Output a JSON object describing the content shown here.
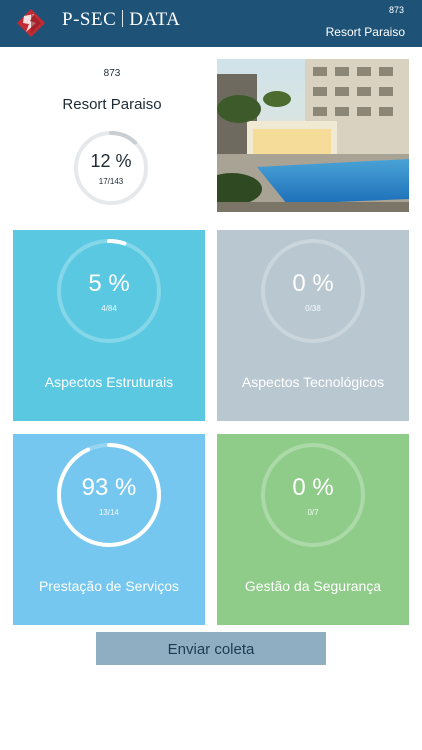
{
  "header": {
    "brand_left": "P-SEC",
    "brand_right": "DATA",
    "code": "873",
    "name": "Resort Paraiso",
    "logo_icon": "psec-logo-icon"
  },
  "summary": {
    "code": "873",
    "name": "Resort Paraiso",
    "percent_text": "12 %",
    "fraction": "17/143",
    "progress": 0.12
  },
  "photo": {
    "icon": "resort-pool-photo"
  },
  "categories": [
    {
      "percent_text": "5 %",
      "fraction": "4/84",
      "label": "Aspectos Estruturais",
      "progress": 0.05,
      "color": "#5bc8e2"
    },
    {
      "percent_text": "0 %",
      "fraction": "0/38",
      "label": "Aspectos Tecnológicos",
      "progress": 0.0,
      "color": "#b9c7d0"
    },
    {
      "percent_text": "93 %",
      "fraction": "13/14",
      "label": "Prestação de Serviços",
      "progress": 0.93,
      "color": "#76c7ef"
    },
    {
      "percent_text": "0 %",
      "fraction": "0/7",
      "label": "Gestão da Segurança",
      "progress": 0.0,
      "color": "#8fcc8a"
    }
  ],
  "actions": {
    "submit_label": "Enviar coleta"
  },
  "colors": {
    "header_bg": "#1f5277",
    "button_bg": "#8faec2",
    "ring_track": "#e6e9ec"
  }
}
